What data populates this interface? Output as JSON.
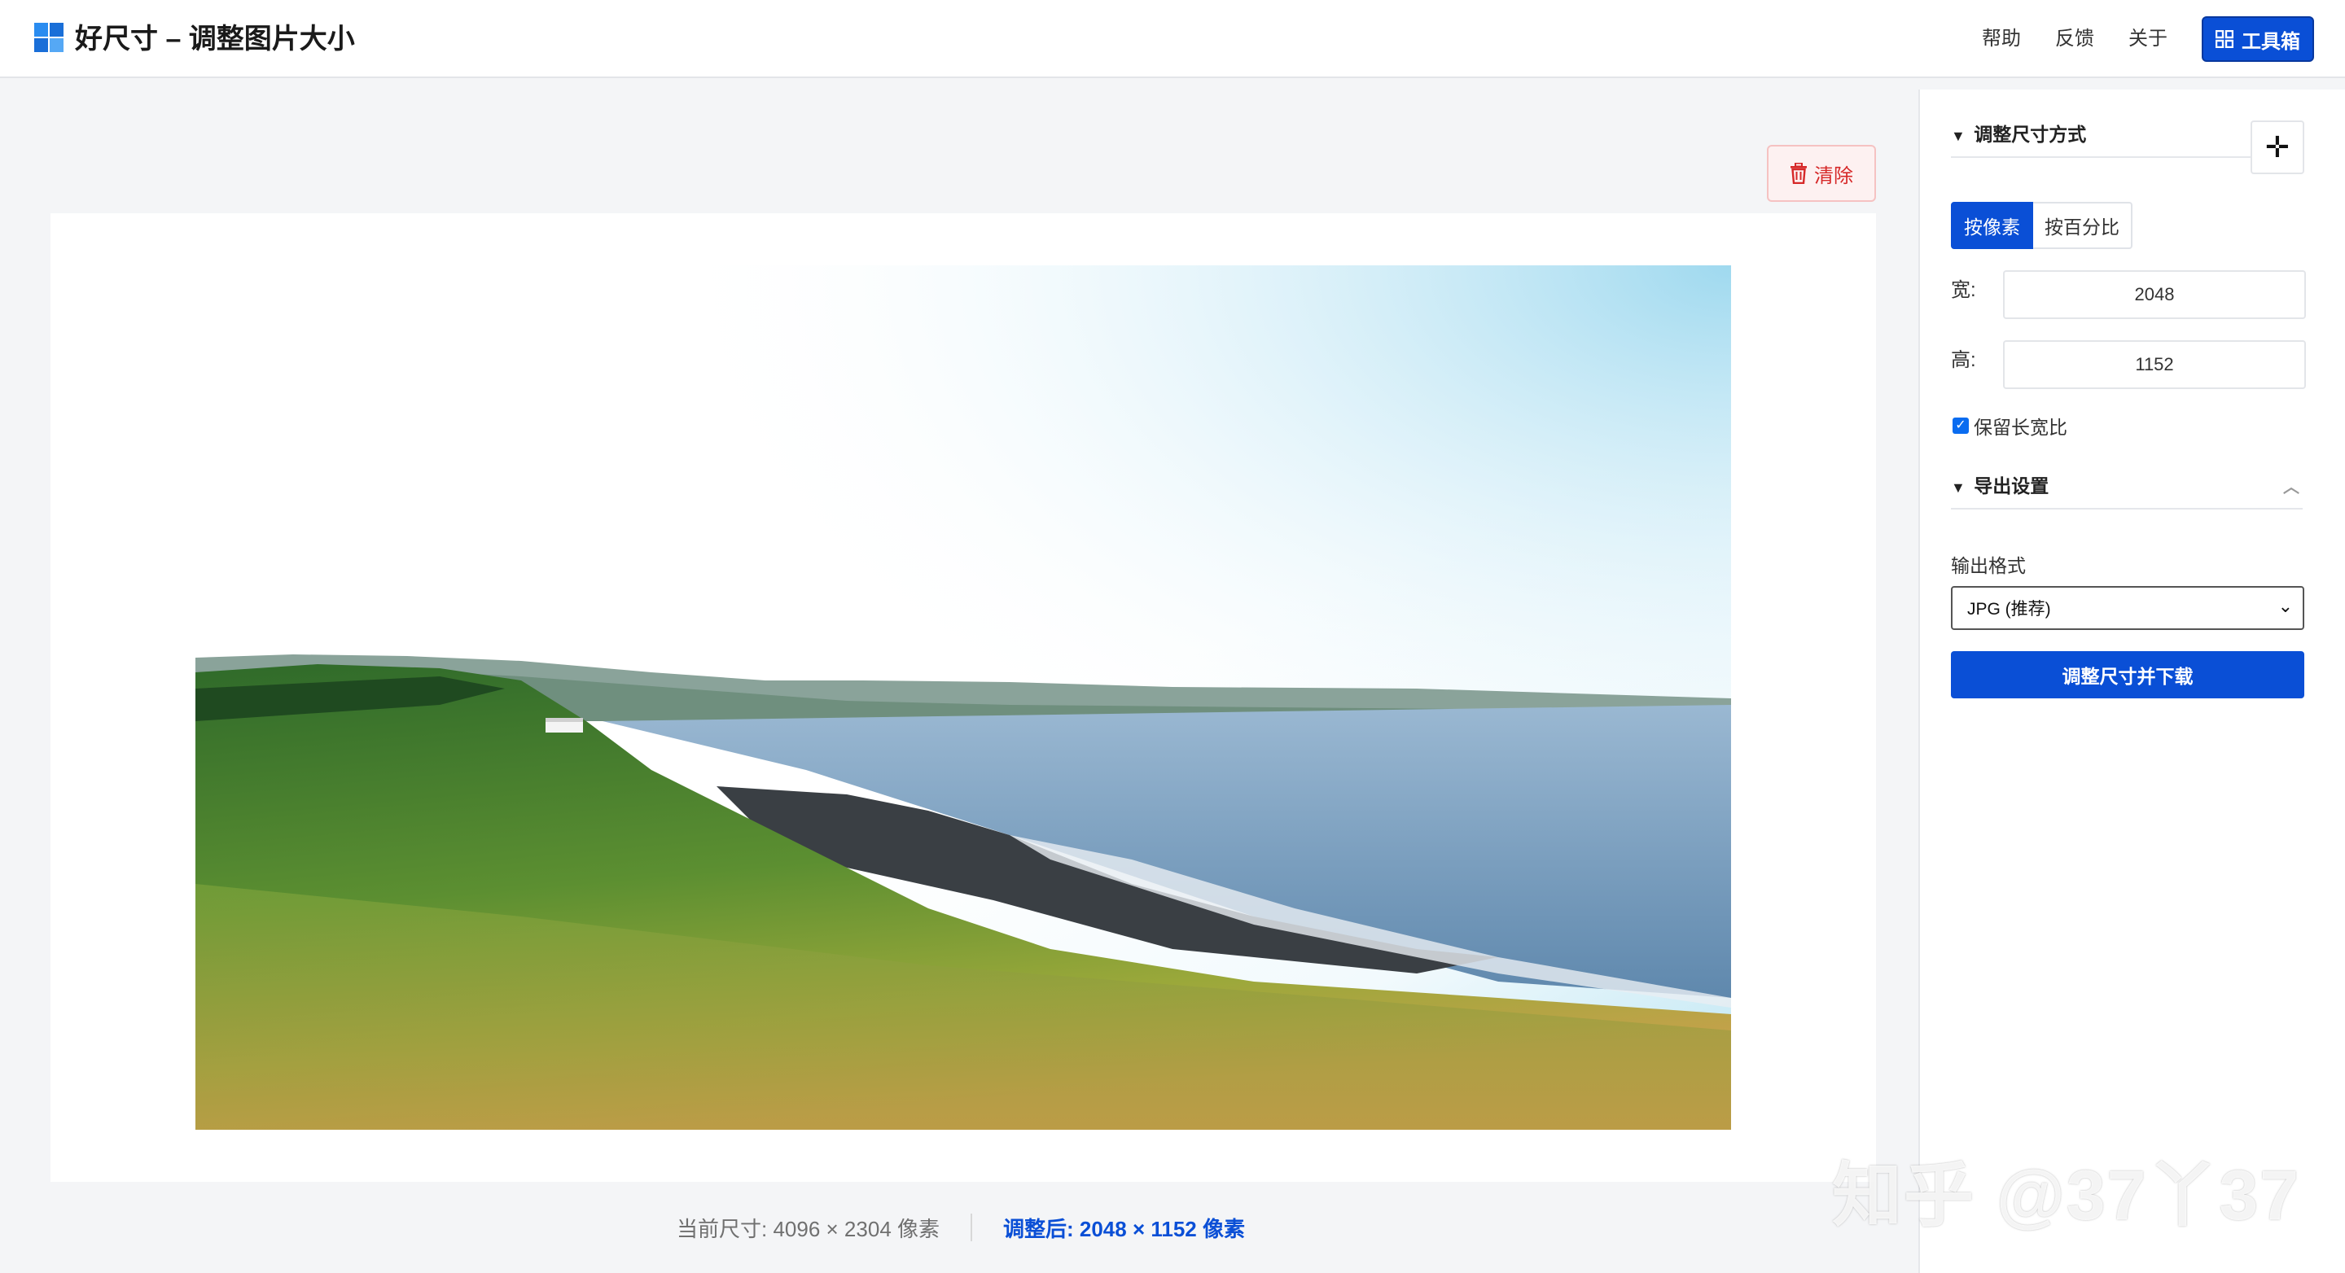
{
  "header": {
    "title": "好尺寸 – 调整图片大小",
    "nav": [
      "帮助",
      "反馈",
      "关于"
    ],
    "toolbox_label": "工具箱"
  },
  "main": {
    "clear_label": "清除",
    "current_size": "当前尺寸: 4096 × 2304 像素",
    "resized_size": "调整后: 2048 × 1152 像素"
  },
  "sidebar": {
    "resize_section_title": "调整尺寸方式",
    "float_button_glyph": "✛",
    "mode_tabs": [
      "按像素",
      "按百分比"
    ],
    "width_label": "宽:",
    "width_value": "2048",
    "height_label": "高:",
    "height_value": "1152",
    "keep_ratio_label": "保留长宽比",
    "keep_ratio_checked": true,
    "export_section_title": "导出设置",
    "format_label": "输出格式",
    "format_selected": "JPG (推荐)",
    "download_label": "调整尺寸并下载"
  },
  "watermark": "知乎 @37丫37",
  "colors": {
    "accent": "#0a4fd6",
    "danger": "#d62828",
    "background": "#f4f5f7"
  }
}
